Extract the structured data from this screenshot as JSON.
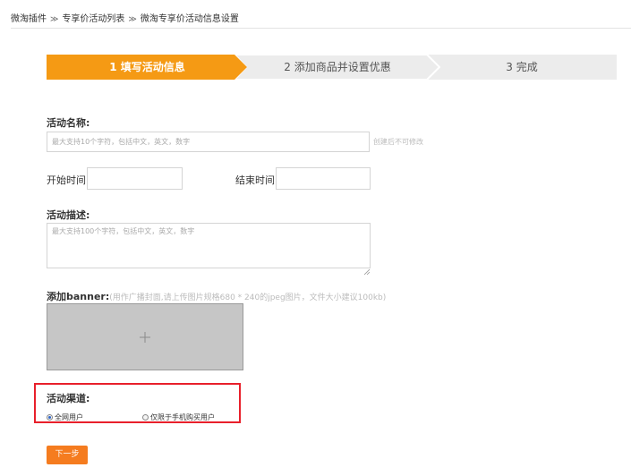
{
  "breadcrumb": {
    "items": [
      "微淘插件",
      "专享价活动列表",
      "微淘专享价活动信息设置"
    ],
    "separator": "≫"
  },
  "steps": [
    {
      "label": "1  填写活动信息",
      "active": true
    },
    {
      "label": "2  添加商品并设置优惠",
      "active": false
    },
    {
      "label": "3  完成",
      "active": false
    }
  ],
  "colors": {
    "accent": "#f59a14",
    "step_inactive": "#ececec",
    "highlight_border": "#e8202b",
    "button": "#f57c1f"
  },
  "form": {
    "name_label": "活动名称:",
    "name_placeholder": "最大支持10个字符，包括中文，英文，数字",
    "name_hint": "创建后不可修改",
    "start_label": "开始时间:",
    "end_label": "结束时间:",
    "desc_label": "活动描述:",
    "desc_placeholder": "最大支持100个字符，包括中文，英文，数字",
    "banner_label": "添加banner:",
    "banner_hint": "(用作广播封面,请上传图片规格680 * 240的jpeg图片，文件大小建议100kb)",
    "banner_icon": "plus-icon",
    "channel_label": "活动渠道:",
    "channel_options": [
      {
        "label": "全网用户",
        "selected": true
      },
      {
        "label": "仅限于手机购买用户",
        "selected": false
      }
    ],
    "next_button": "下一步"
  }
}
